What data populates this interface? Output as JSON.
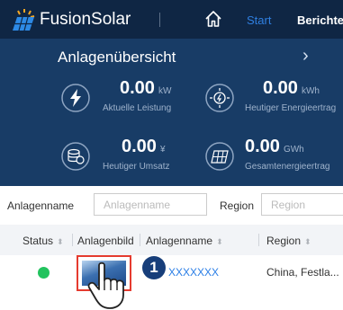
{
  "header": {
    "brand": "FusionSolar",
    "nav_start": "Start",
    "nav_berichte": "Berichte"
  },
  "overview": {
    "title": "Anlagenübersicht",
    "kpis": [
      {
        "value": "0.00",
        "unit": "kW",
        "label": "Aktuelle Leistung",
        "icon": "lightning-icon"
      },
      {
        "value": "0.00",
        "unit": "kWh",
        "label": "Heutiger Energieertrag",
        "icon": "energy-yield-icon"
      },
      {
        "value": "0.00",
        "unit": "¥",
        "label": "Heutiger Umsatz",
        "icon": "revenue-icon"
      },
      {
        "value": "0.00",
        "unit": "GWh",
        "label": "Gesamtenergieertrag",
        "icon": "solar-panel-icon"
      }
    ]
  },
  "filters": {
    "name_label": "Anlagenname",
    "name_placeholder": "Anlagenname",
    "region_label": "Region",
    "region_placeholder": "Region"
  },
  "table": {
    "columns": [
      "Status",
      "Anlagenbild",
      "Anlagenname",
      "Region"
    ],
    "rows": [
      {
        "status": "online",
        "name": "XXXXXXX",
        "region": "China, Festla..."
      }
    ]
  },
  "callout": {
    "step": "1"
  },
  "colors": {
    "header_bg": "#0f2644",
    "panel_bg": "#183c66",
    "accent": "#2f7fe0",
    "status_ok": "#22c35e",
    "highlight": "#e53b2f"
  }
}
